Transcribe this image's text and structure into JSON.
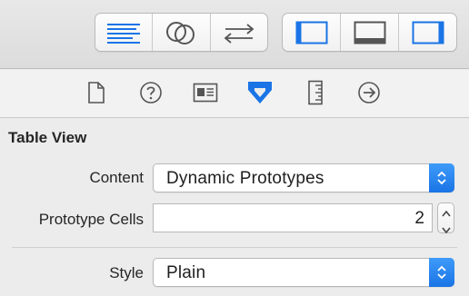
{
  "toolbar": {
    "editor_group": [
      {
        "icon": "standard-editor-icon",
        "selected": true
      },
      {
        "icon": "assistant-editor-icon",
        "selected": false
      },
      {
        "icon": "version-editor-icon",
        "selected": false
      }
    ],
    "view_group": [
      {
        "icon": "navigator-toggle-icon",
        "active": true
      },
      {
        "icon": "debug-area-toggle-icon",
        "active": false
      },
      {
        "icon": "utilities-toggle-icon",
        "active": true
      }
    ]
  },
  "inspectors": [
    {
      "icon": "file-inspector-icon",
      "selected": false
    },
    {
      "icon": "quick-help-icon",
      "selected": false
    },
    {
      "icon": "identity-inspector-icon",
      "selected": false
    },
    {
      "icon": "attributes-inspector-icon",
      "selected": true
    },
    {
      "icon": "size-inspector-icon",
      "selected": false
    },
    {
      "icon": "connections-inspector-icon",
      "selected": false
    }
  ],
  "table_view": {
    "section_title": "Table View",
    "content_label": "Content",
    "content_value": "Dynamic Prototypes",
    "prototype_cells_label": "Prototype Cells",
    "prototype_cells_value": "2",
    "style_label": "Style",
    "style_value": "Plain"
  },
  "colors": {
    "accent": "#1a74e6",
    "icon_gray": "#555555",
    "background": "#ececec"
  }
}
